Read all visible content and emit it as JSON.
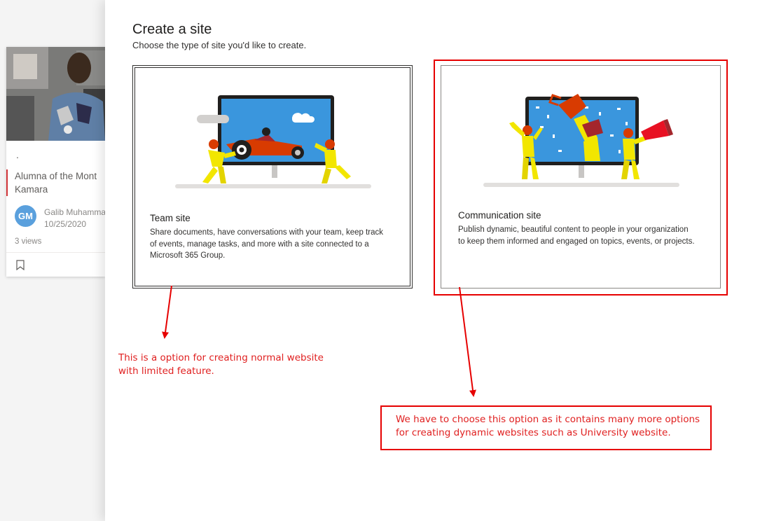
{
  "background": {
    "news": {
      "dot": ".",
      "title_line1": "Alumna of the Mont",
      "title_line2": "Kamara",
      "avatar_initials": "GM",
      "author": "Galib Muhamma",
      "date": "10/25/2020",
      "views": "3 views"
    }
  },
  "panel": {
    "title": "Create a site",
    "subtitle": "Choose the type of site you'd like to create.",
    "options": [
      {
        "title": "Team site",
        "description": "Share documents, have conversations with your team, keep track of events, manage tasks, and more with a site connected to a Microsoft 365 Group."
      },
      {
        "title": "Communication site",
        "description": "Publish dynamic, beautiful content to people in your organization to keep them informed and engaged on topics, events, or projects."
      }
    ]
  },
  "annotations": {
    "note_team_line1": "This is a option for creating normal website",
    "note_team_line2": "with limited feature.",
    "note_comm_line1": "We have to choose this option as it contains many more options",
    "note_comm_line2": "for creating dynamic websites such as University website."
  },
  "colors": {
    "annotation_red": "#e60000",
    "screen_blue": "#3a96dd",
    "figure_yellow": "#f2e600",
    "accent_red": "#d13438"
  }
}
